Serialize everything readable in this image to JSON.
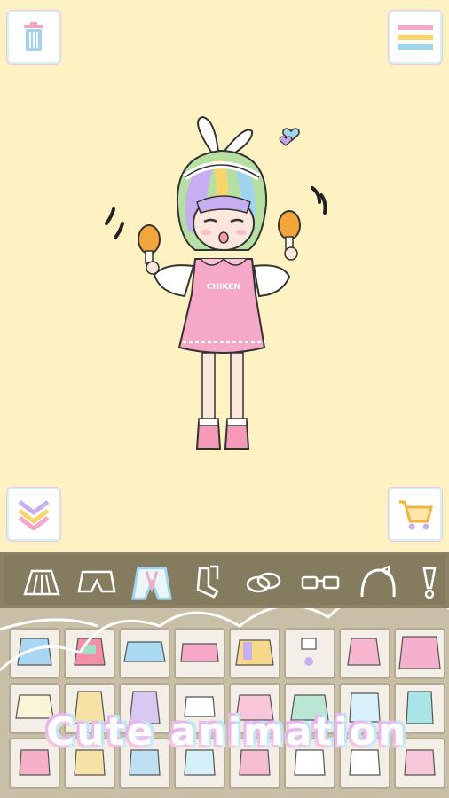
{
  "caption": "Cute animation",
  "stage": {
    "shirt_text": "CHIKEN",
    "top_left_button": "trash-icon",
    "top_right_button": "menu-icon",
    "bottom_left_button": "collapse-icon",
    "bottom_right_button": "cart-icon"
  },
  "categories": [
    "skirt-icon",
    "shorts-icon",
    "outerwear-icon",
    "socks-icon",
    "shoes-icon",
    "glasses-icon",
    "headband-icon",
    "accessory-icon"
  ],
  "selected_category": "outerwear-icon",
  "colors": {
    "background": "#fef2c3",
    "toolbar": "#857c60",
    "grid": "#c9bfa6",
    "dress": "#f5a9c6",
    "accent_pink": "#f7a8c8",
    "accent_blue": "#9fd5ee"
  }
}
